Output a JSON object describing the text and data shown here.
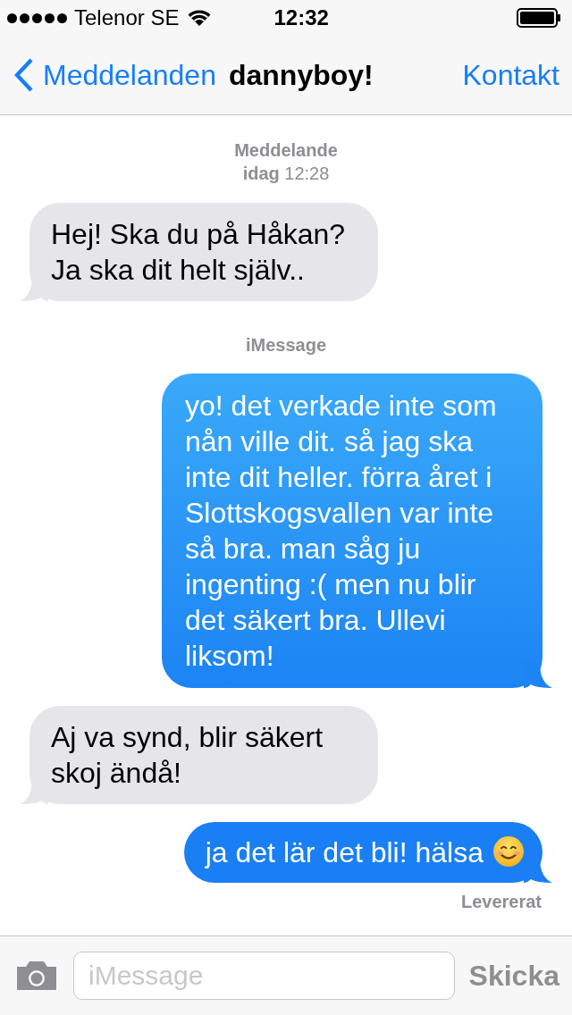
{
  "status_bar": {
    "carrier": "Telenor SE",
    "time": "12:32"
  },
  "nav": {
    "back": "Meddelanden",
    "title": "dannyboy!",
    "action": "Kontakt"
  },
  "thread": [
    {
      "kind": "header",
      "label": "Meddelande",
      "date": "idag",
      "time": "12:28"
    },
    {
      "kind": "incoming",
      "text": "Hej! Ska du på Håkan? Ja ska dit helt själv.."
    },
    {
      "kind": "label",
      "text": "iMessage"
    },
    {
      "kind": "outgoing",
      "text": "yo! det verkade inte som nån ville dit. så jag ska inte dit heller. förra året i Slottskogsvallen var inte så bra. man såg ju ingenting :( men nu blir det säkert bra. Ullevi liksom!"
    },
    {
      "kind": "incoming",
      "text": "Aj va synd, blir säkert skoj ändå!"
    },
    {
      "kind": "outgoing",
      "text": "ja det lär det bli! hälsa",
      "smiley": true
    },
    {
      "kind": "status",
      "text": "Levererat"
    }
  ],
  "composer": {
    "placeholder": "iMessage",
    "send": "Skicka",
    "send_disabled": true
  }
}
